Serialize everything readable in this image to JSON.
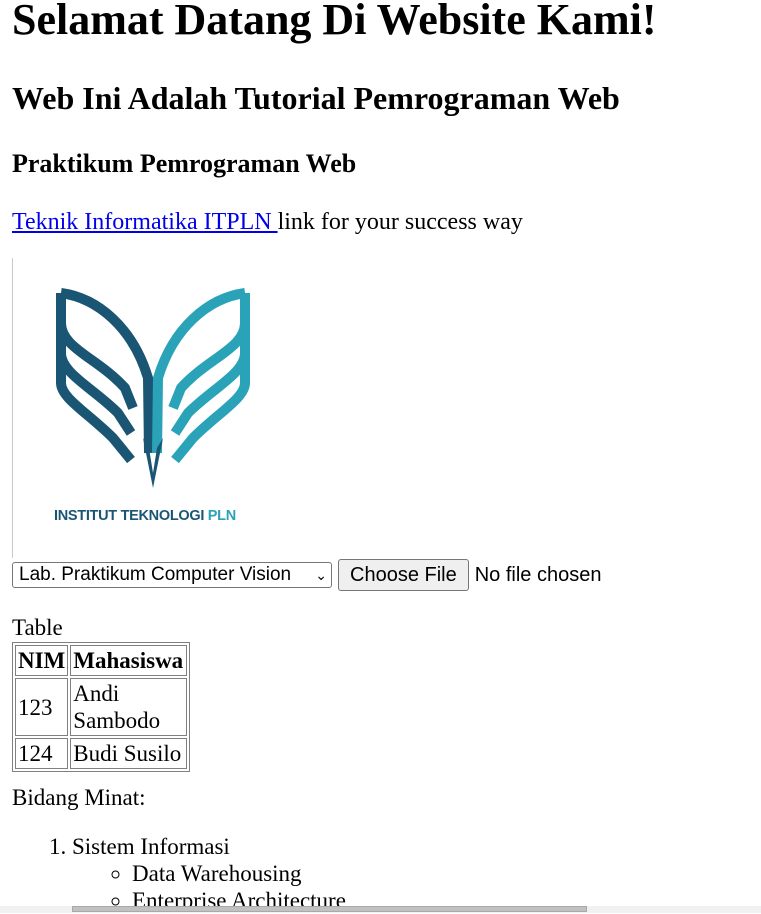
{
  "heading1": "Selamat Datang Di Website Kami!",
  "heading2": "Web Ini Adalah Tutorial Pemrograman Web",
  "heading3": "Praktikum Pemrograman Web",
  "link": {
    "text": "Teknik Informatika ITPLN ",
    "suffix": "link for your success way"
  },
  "logo": {
    "caption_main": "INSTITUT TEKNOLOGI ",
    "caption_accent": "PLN",
    "color_dark": "#1a5673",
    "color_light": "#2aa3b8"
  },
  "form": {
    "select_value": "Lab. Praktikum Computer Vision",
    "file_button": "Choose File",
    "file_status": "No file chosen"
  },
  "table": {
    "label": "Table",
    "headers": [
      "NIM",
      "Mahasiswa"
    ],
    "rows": [
      [
        "123",
        "Andi Sambodo"
      ],
      [
        "124",
        "Budi Susilo"
      ]
    ]
  },
  "bidang": {
    "label": "Bidang Minat:",
    "items": [
      {
        "label": "Sistem Informasi",
        "sub": [
          "Data Warehousing",
          "Enterprise Architecture"
        ]
      }
    ]
  }
}
